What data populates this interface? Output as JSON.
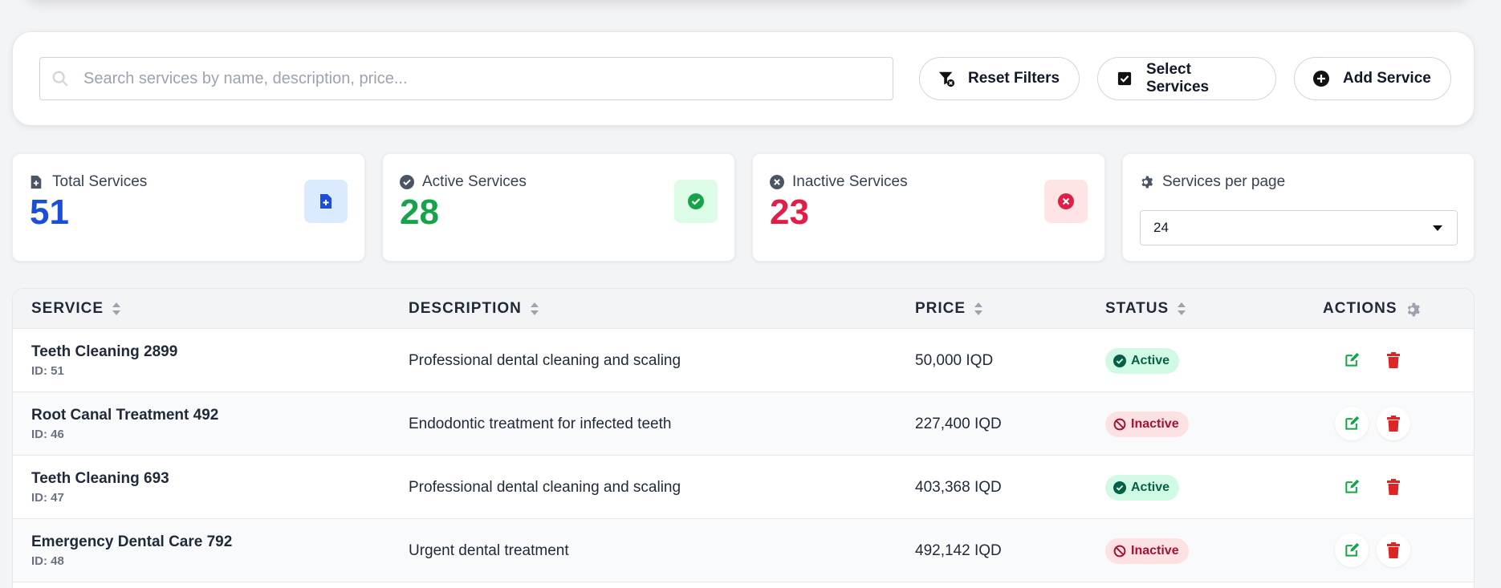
{
  "toolbar": {
    "search_placeholder": "Search services by name, description, price...",
    "search_value": "",
    "reset_label": "Reset Filters",
    "select_label": "Select Services",
    "add_label": "Add Service"
  },
  "stats": {
    "total": {
      "label": "Total Services",
      "value": "51",
      "color": "#1d4ed8"
    },
    "active": {
      "label": "Active Services",
      "value": "28",
      "color": "#16a34a"
    },
    "inactive": {
      "label": "Inactive Services",
      "value": "23",
      "color": "#e11d48"
    },
    "per_page": {
      "label": "Services per page",
      "selected": "24"
    }
  },
  "table": {
    "headers": {
      "service": "SERVICE",
      "description": "DESCRIPTION",
      "price": "PRICE",
      "status": "STATUS",
      "actions": "ACTIONS"
    },
    "rows": [
      {
        "name": "Teeth Cleaning 2899",
        "id": "ID: 51",
        "description": "Professional dental cleaning and scaling",
        "price": "50,000 IQD",
        "status": "Active"
      },
      {
        "name": "Root Canal Treatment 492",
        "id": "ID: 46",
        "description": "Endodontic treatment for infected teeth",
        "price": "227,400 IQD",
        "status": "Inactive"
      },
      {
        "name": "Teeth Cleaning 693",
        "id": "ID: 47",
        "description": "Professional dental cleaning and scaling",
        "price": "403,368 IQD",
        "status": "Active"
      },
      {
        "name": "Emergency Dental Care 792",
        "id": "ID: 48",
        "description": "Urgent dental treatment",
        "price": "492,142 IQD",
        "status": "Inactive"
      }
    ]
  },
  "icons": {
    "search": "search-icon",
    "reset": "filter-reset-icon",
    "select": "checkbox-icon",
    "add": "plus-circle-icon",
    "edit": "edit-icon",
    "delete": "trash-icon",
    "sort": "sort-icon",
    "settings": "gear-icon"
  }
}
